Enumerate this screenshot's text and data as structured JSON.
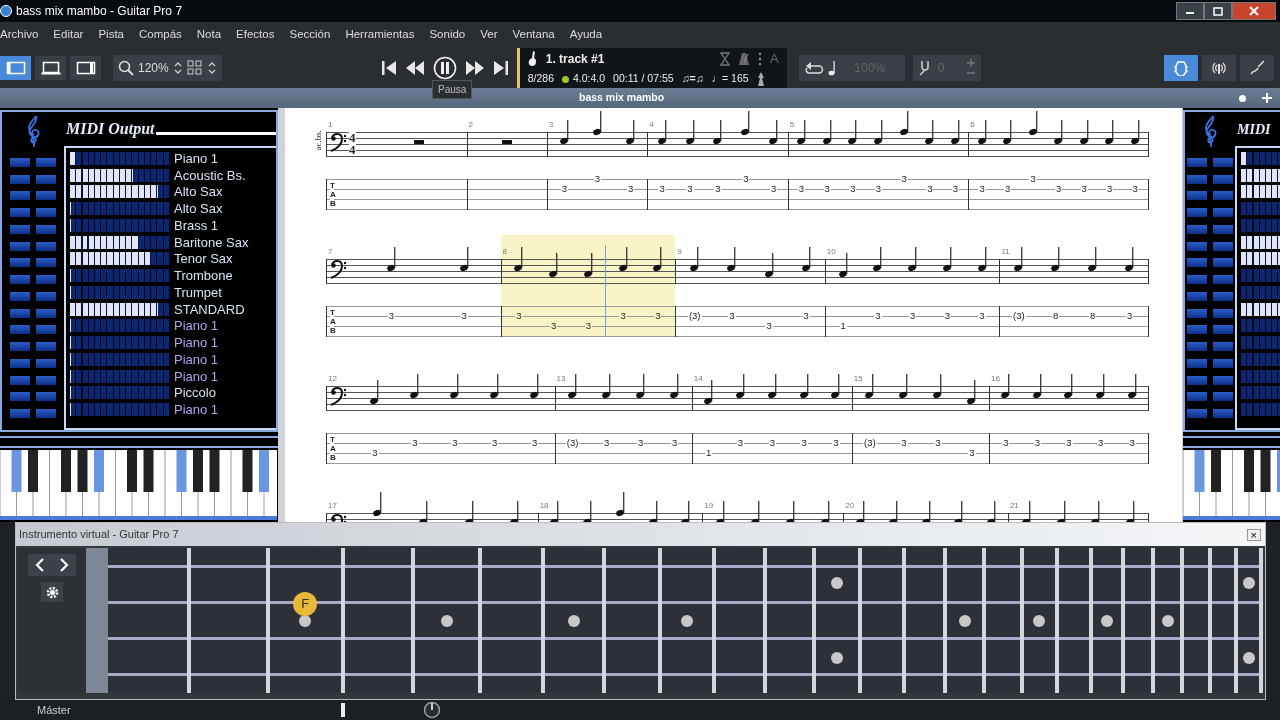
{
  "window": {
    "title": "bass mix mambo - Guitar Pro 7"
  },
  "menu": [
    "Archivo",
    "Editar",
    "Pista",
    "Compás",
    "Nota",
    "Efectos",
    "Sección",
    "Herramientas",
    "Sonido",
    "Ver",
    "Ventana",
    "Ayuda"
  ],
  "toolbar": {
    "views": [
      {
        "selected": true
      },
      {
        "selected": false
      },
      {
        "selected": false
      }
    ],
    "zoom": "120%",
    "playing": true,
    "tooltip": "Pausa",
    "track": {
      "name": "1. track #1",
      "position": "8/286",
      "time_signature": "4.0:4.0",
      "time": "00:11 / 07:55",
      "swing": "♫=♫",
      "tempo": "♩= 165",
      "text_tool": "A"
    },
    "speed": "100%",
    "transpose": "0",
    "panels": [
      {
        "selected": true
      },
      {
        "selected": false
      },
      {
        "selected": false
      }
    ]
  },
  "document_tab": {
    "title": "bass mix mambo"
  },
  "midi_left": {
    "title": "MIDI Output",
    "channels": [
      {
        "name": "Piano 1",
        "level": 0.06,
        "color": "#d8e4f4"
      },
      {
        "name": "Acoustic Bs.",
        "level": 0.62,
        "color": "#d8e4f4"
      },
      {
        "name": "Alto Sax",
        "level": 0.88,
        "color": "#d8e4f4"
      },
      {
        "name": "Alto Sax",
        "level": 0,
        "color": "#d8e4f4"
      },
      {
        "name": "Brass 1",
        "level": 0,
        "color": "#d8e4f4"
      },
      {
        "name": "Baritone Sax",
        "level": 0.69,
        "color": "#d8e4f4"
      },
      {
        "name": "Tenor Sax",
        "level": 0.81,
        "color": "#d8e4f4"
      },
      {
        "name": "Trombone",
        "level": 0,
        "color": "#d8e4f4"
      },
      {
        "name": "Trumpet",
        "level": 0,
        "color": "#d8e4f4"
      },
      {
        "name": "STANDARD",
        "level": 0.88,
        "color": "#d8e4f4"
      },
      {
        "name": "Piano 1",
        "level": 0,
        "color": "#b4a4f0"
      },
      {
        "name": "Piano 1",
        "level": 0,
        "color": "#b4a4f0"
      },
      {
        "name": "Piano 1",
        "level": 0,
        "color": "#b4a4f0"
      },
      {
        "name": "Piano 1",
        "level": 0,
        "color": "#b4a4f0"
      },
      {
        "name": "Piccolo",
        "level": 0,
        "color": "#d8e4f4"
      },
      {
        "name": "Piano 1",
        "level": 0,
        "color": "#b4a4f0"
      }
    ]
  },
  "midi_right": {
    "title": "MIDI"
  },
  "score": {
    "instrument": "ac.bs.",
    "time_signature": [
      "4",
      "4"
    ],
    "systems": [
      {
        "tab_label": [
          "T",
          "A",
          "B"
        ],
        "measures": [
          {
            "number": "1",
            "selected": false
          },
          {
            "number": "2",
            "selected": false
          },
          {
            "number": "3",
            "selected": false,
            "notes": [
              {
                "fret": "3",
                "kind": "mid"
              },
              {
                "fret": "3",
                "kind": "high"
              },
              {
                "fret": "3",
                "kind": "mid"
              }
            ]
          },
          {
            "number": "4",
            "selected": false,
            "notes": [
              {
                "fret": "3",
                "kind": "mid"
              },
              {
                "fret": "3",
                "kind": "mid"
              },
              {
                "fret": "3",
                "kind": "mid"
              },
              {
                "fret": "3",
                "kind": "high"
              },
              {
                "fret": "3",
                "kind": "mid"
              }
            ]
          },
          {
            "number": "5",
            "selected": false,
            "notes": [
              {
                "fret": "3",
                "kind": "mid"
              },
              {
                "fret": "3",
                "kind": "mid"
              },
              {
                "fret": "3",
                "kind": "mid"
              },
              {
                "fret": "3",
                "kind": "mid"
              },
              {
                "fret": "3",
                "kind": "high"
              },
              {
                "fret": "3",
                "kind": "mid"
              },
              {
                "fret": "3",
                "kind": "mid"
              }
            ]
          },
          {
            "number": "6",
            "selected": false,
            "notes": [
              {
                "fret": "3",
                "kind": "mid"
              },
              {
                "fret": "3",
                "kind": "mid"
              },
              {
                "fret": "3",
                "kind": "high"
              },
              {
                "fret": "3",
                "kind": "mid"
              },
              {
                "fret": "3",
                "kind": "mid"
              },
              {
                "fret": "3",
                "kind": "mid"
              },
              {
                "fret": "3",
                "kind": "mid"
              }
            ]
          }
        ]
      },
      {
        "tab_label": [
          "T",
          "A",
          "B"
        ],
        "measures": [
          {
            "number": "7",
            "selected": false,
            "notes": [
              {
                "fret": "3",
                "kind": "mid"
              },
              {
                "fret": "3",
                "kind": "mid"
              }
            ]
          },
          {
            "number": "8",
            "selected": true,
            "notes": [
              {
                "fret": "3",
                "kind": "mid"
              },
              {
                "fret": "3",
                "kind": "low"
              },
              {
                "fret": "3",
                "kind": "low"
              },
              {
                "fret": "3",
                "kind": "mid"
              },
              {
                "fret": "3",
                "kind": "mid"
              }
            ]
          },
          {
            "number": "9",
            "selected": false,
            "notes": [
              {
                "fret": "(3)",
                "kind": "mid"
              },
              {
                "fret": "3",
                "kind": "mid"
              },
              {
                "fret": "3",
                "kind": "low"
              },
              {
                "fret": "3",
                "kind": "mid"
              }
            ]
          },
          {
            "number": "10",
            "selected": false,
            "notes": [
              {
                "fret": "1",
                "kind": "low"
              },
              {
                "fret": "3",
                "kind": "mid"
              },
              {
                "fret": "3",
                "kind": "mid"
              },
              {
                "fret": "3",
                "kind": "mid"
              },
              {
                "fret": "3",
                "kind": "mid"
              }
            ]
          },
          {
            "number": "11",
            "selected": false,
            "notes": [
              {
                "fret": "(3)",
                "kind": "mid"
              },
              {
                "fret": "8",
                "kind": "mid"
              },
              {
                "fret": "8",
                "kind": "mid"
              },
              {
                "fret": "3",
                "kind": "mid"
              }
            ]
          }
        ]
      },
      {
        "tab_label": [
          "T",
          "A",
          "B"
        ],
        "measures": [
          {
            "number": "12",
            "selected": false,
            "notes": [
              {
                "fret": "3",
                "kind": "low"
              },
              {
                "fret": "3",
                "kind": "mid"
              },
              {
                "fret": "3",
                "kind": "mid"
              },
              {
                "fret": "3",
                "kind": "mid"
              },
              {
                "fret": "3",
                "kind": "mid"
              }
            ]
          },
          {
            "number": "13",
            "selected": false,
            "notes": [
              {
                "fret": "(3)",
                "kind": "mid"
              },
              {
                "fret": "3",
                "kind": "mid"
              },
              {
                "fret": "3",
                "kind": "mid"
              },
              {
                "fret": "3",
                "kind": "mid"
              }
            ]
          },
          {
            "number": "14",
            "selected": false,
            "notes": [
              {
                "fret": "1",
                "kind": "low"
              },
              {
                "fret": "3",
                "kind": "mid"
              },
              {
                "fret": "3",
                "kind": "mid"
              },
              {
                "fret": "3",
                "kind": "mid"
              },
              {
                "fret": "3",
                "kind": "mid"
              }
            ]
          },
          {
            "number": "15",
            "selected": false,
            "notes": [
              {
                "fret": "(3)",
                "kind": "mid"
              },
              {
                "fret": "3",
                "kind": "mid"
              },
              {
                "fret": "3",
                "kind": "mid"
              },
              {
                "fret": "3",
                "kind": "low"
              }
            ]
          },
          {
            "number": "16",
            "selected": false,
            "notes": [
              {
                "fret": "3",
                "kind": "mid"
              },
              {
                "fret": "3",
                "kind": "mid"
              },
              {
                "fret": "3",
                "kind": "mid"
              },
              {
                "fret": "3",
                "kind": "mid"
              },
              {
                "fret": "3",
                "kind": "mid"
              }
            ]
          }
        ]
      },
      {
        "measures": [
          {
            "number": "17",
            "selected": false,
            "notes": [
              {
                "kind": "high"
              },
              {
                "kind": "mid"
              },
              {
                "kind": "mid"
              },
              {
                "kind": "mid"
              }
            ]
          },
          {
            "number": "18",
            "selected": false,
            "notes": [
              {
                "kind": "mid"
              },
              {
                "kind": "mid"
              },
              {
                "kind": "high"
              },
              {
                "kind": "mid"
              },
              {
                "kind": "mid"
              }
            ]
          },
          {
            "number": "19",
            "selected": false,
            "notes": [
              {
                "kind": "mid"
              },
              {
                "kind": "mid"
              },
              {
                "kind": "mid"
              },
              {
                "kind": "mid"
              }
            ]
          },
          {
            "number": "20",
            "selected": false,
            "notes": [
              {
                "kind": "mid"
              },
              {
                "kind": "mid"
              },
              {
                "kind": "mid"
              },
              {
                "kind": "mid"
              },
              {
                "kind": "mid"
              }
            ]
          },
          {
            "number": "21",
            "selected": false,
            "notes": [
              {
                "kind": "mid"
              },
              {
                "kind": "mid"
              },
              {
                "kind": "mid"
              },
              {
                "kind": "mid"
              }
            ]
          }
        ]
      }
    ]
  },
  "instrument_window": {
    "title": "Instrumento virtual - Guitar Pro 7",
    "close": "×",
    "note_marker": "F"
  },
  "status_bar": {
    "label": "Máster"
  }
}
